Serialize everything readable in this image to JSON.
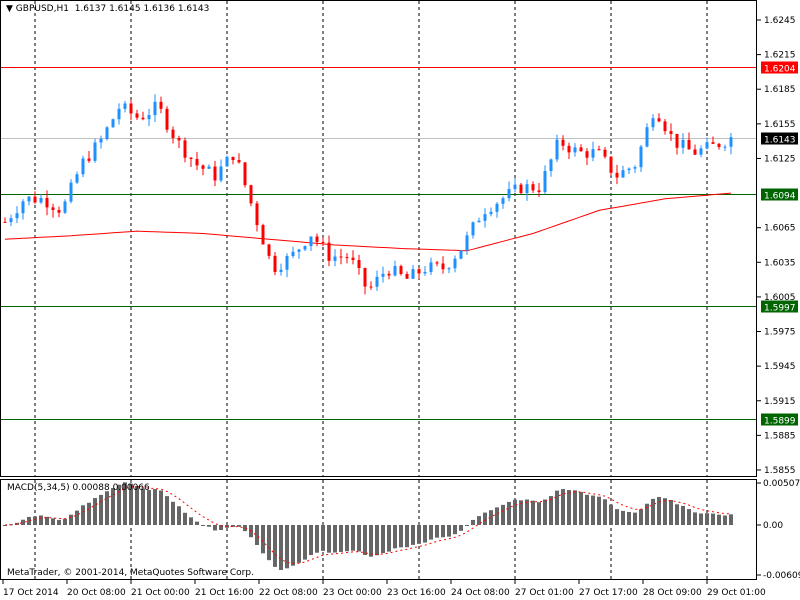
{
  "header": {
    "symbol": "GBPUSD,H1",
    "open": "1.6137",
    "high": "1.6145",
    "low": "1.6136",
    "close": "1.6143"
  },
  "price_axis": [
    "1.6245",
    "1.6215",
    "1.6185",
    "1.6155",
    "1.6125",
    "1.6065",
    "1.6035",
    "1.6005",
    "1.5975",
    "1.5945",
    "1.5915",
    "1.5885",
    "1.5855"
  ],
  "levels": [
    {
      "value": "1.6204",
      "color": "#ff0000",
      "text_color": "#ffffff"
    },
    {
      "value": "1.6143",
      "color": "#c0c0c0",
      "bg": "#000000",
      "text_color": "#ffffff"
    },
    {
      "value": "1.6094",
      "color": "#006400",
      "text_color": "#ffffff"
    },
    {
      "value": "1.5997",
      "color": "#006400",
      "text_color": "#ffffff"
    },
    {
      "value": "1.5899",
      "color": "#006400",
      "text_color": "#ffffff"
    }
  ],
  "macd": {
    "label": "MACD(5,34,5) 0.00088 0.00066",
    "axis": [
      "0.00507",
      "0.00",
      "-0.00609"
    ]
  },
  "copyright": "MetaTrader, © 2001-2014, MetaQuotes Software Corp.",
  "time_axis": [
    "17 Oct 2014",
    "20 Oct 08:00",
    "21 Oct 00:00",
    "21 Oct 16:00",
    "22 Oct 08:00",
    "23 Oct 00:00",
    "23 Oct 16:00",
    "24 Oct 08:00",
    "27 Oct 01:00",
    "27 Oct 17:00",
    "28 Oct 09:00",
    "29 Oct 01:00"
  ],
  "colors": {
    "bull": "#1e90ff",
    "bear": "#ff0000",
    "ma": "#ff0000",
    "macd_hist": "#666666",
    "macd_signal": "#ff0000"
  },
  "chart_data": {
    "type": "candlestick",
    "title": "GBPUSD,H1",
    "ylim": [
      1.5855,
      1.6245
    ],
    "close_path": [
      1.607,
      1.609,
      1.609,
      1.608,
      1.612,
      1.614,
      1.617,
      1.616,
      1.617,
      1.614,
      1.612,
      1.611,
      1.613,
      1.608,
      1.603,
      1.604,
      1.606,
      1.604,
      1.604,
      1.601,
      1.603,
      1.602,
      1.603,
      1.603,
      1.605,
      1.608,
      1.609,
      1.61,
      1.61,
      1.614,
      1.613,
      1.613,
      1.611,
      1.612,
      1.617,
      1.614,
      1.613,
      1.6135,
      1.6143
    ],
    "ma_path": [
      1.6055,
      1.6058,
      1.6062,
      1.606,
      1.6055,
      1.605,
      1.6047,
      1.6045,
      1.606,
      1.608,
      1.609,
      1.6095
    ]
  }
}
